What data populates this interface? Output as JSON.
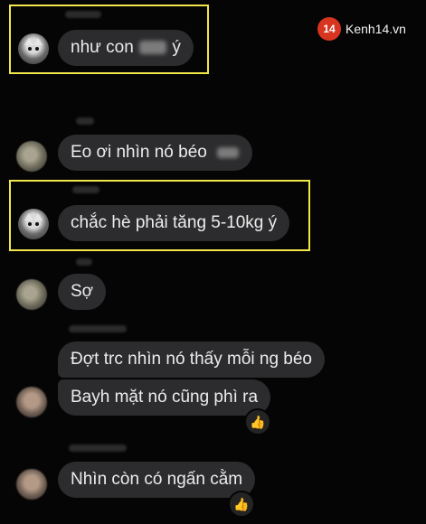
{
  "watermark": {
    "number": "14",
    "text": "Kenh14.vn"
  },
  "messages": [
    {
      "text_before": "như con",
      "text_after": "ý"
    },
    {
      "text": "Eo ơi nhìn nó béo"
    },
    {
      "text": "chắc hè phải tăng 5-10kg ý"
    },
    {
      "text": "Sợ"
    },
    {
      "text": "Đợt trc nhìn nó thấy mỗi ng béo"
    },
    {
      "text": "Bayh mặt nó cũng phì ra"
    },
    {
      "text": "Nhìn còn có ngấn cằm"
    }
  ],
  "reactions": [
    {
      "emoji": "👍"
    },
    {
      "emoji": "👍"
    }
  ],
  "colors": {
    "background": "#050505",
    "bubble": "#2c2c2e",
    "highlight": "#f1e64a",
    "logo_accent": "#d7351f"
  }
}
